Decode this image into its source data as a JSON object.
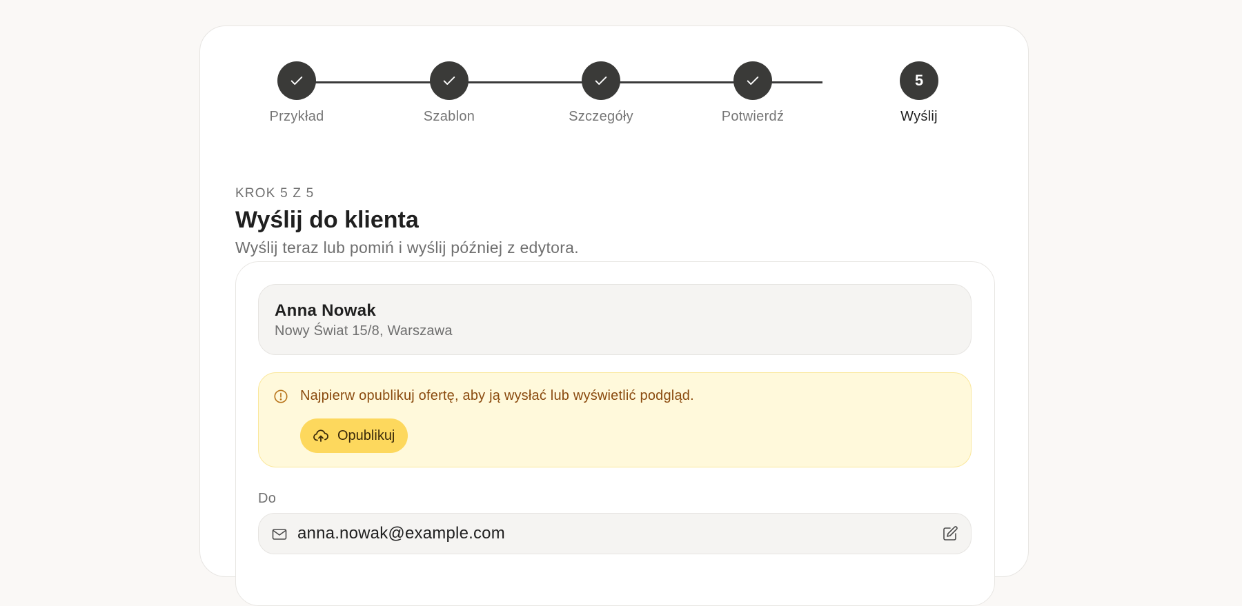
{
  "stepper": {
    "steps": [
      {
        "label": "Przykład",
        "state": "done",
        "icon": "check-icon"
      },
      {
        "label": "Szablon",
        "state": "done",
        "icon": "check-icon"
      },
      {
        "label": "Szczegóły",
        "state": "done",
        "icon": "check-icon"
      },
      {
        "label": "Potwierdź",
        "state": "done",
        "icon": "check-icon"
      },
      {
        "label": "Wyślij",
        "state": "current",
        "number": "5"
      }
    ]
  },
  "header": {
    "kicker": "KROK 5 Z 5",
    "title": "Wyślij do klienta",
    "subtitle": "Wyślij teraz lub pomiń i wyślij później z edytora."
  },
  "client": {
    "name": "Anna Nowak",
    "address": "Nowy Świat 15/8, Warszawa"
  },
  "alert": {
    "icon": "warning-circle-icon",
    "message": "Najpierw opublikuj ofertę, aby ją wysłać lub wyświetlić podgląd.",
    "button_label": "Opublikuj",
    "button_icon": "cloud-upload-icon"
  },
  "recipient": {
    "label": "Do",
    "icon": "mail-icon",
    "email": "anna.nowak@example.com",
    "edit_icon": "edit-pencil-icon"
  },
  "colors": {
    "page_bg": "#faf8f6",
    "step_circle": "#3a3a38",
    "alert_bg": "#fff9db",
    "alert_border": "#fae79a",
    "alert_text": "#8a4a0e",
    "publish_button": "#fdd85d"
  }
}
